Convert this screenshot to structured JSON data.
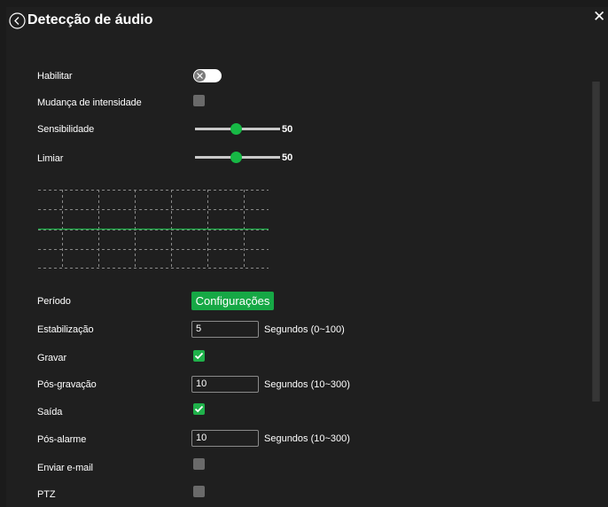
{
  "header": {
    "title": "Detecção de áudio"
  },
  "scrollbar": {
    "position": 0
  },
  "enable": {
    "label": "Habilitar",
    "on": false
  },
  "intensity_change": {
    "label": "Mudança de intensidade",
    "checked": false
  },
  "sensitivity": {
    "label": "Sensibilidade",
    "value": "50"
  },
  "threshold": {
    "label": "Limiar",
    "value": "50"
  },
  "graph": {
    "line_color": "#1fb14a",
    "grid_color": "#8a8a8a"
  },
  "period": {
    "label": "Período",
    "button_label": "Configurações"
  },
  "stabilization": {
    "label": "Estabilização",
    "value": "5",
    "unit": "Segundos (0~100)"
  },
  "record": {
    "label": "Gravar",
    "checked": true
  },
  "post_record": {
    "label": "Pós-gravação",
    "value": "10",
    "unit": "Segundos (10~300)"
  },
  "output": {
    "label": "Saída",
    "checked": true
  },
  "post_alarm": {
    "label": "Pós-alarme",
    "value": "10",
    "unit": "Segundos (10~300)"
  },
  "send_email": {
    "label": "Enviar e-mail",
    "checked": false
  },
  "ptz": {
    "label": "PTZ",
    "checked": false
  },
  "colors": {
    "accent": "#1fb14a",
    "background": "#1f1f1f",
    "text": "#ffffff"
  }
}
